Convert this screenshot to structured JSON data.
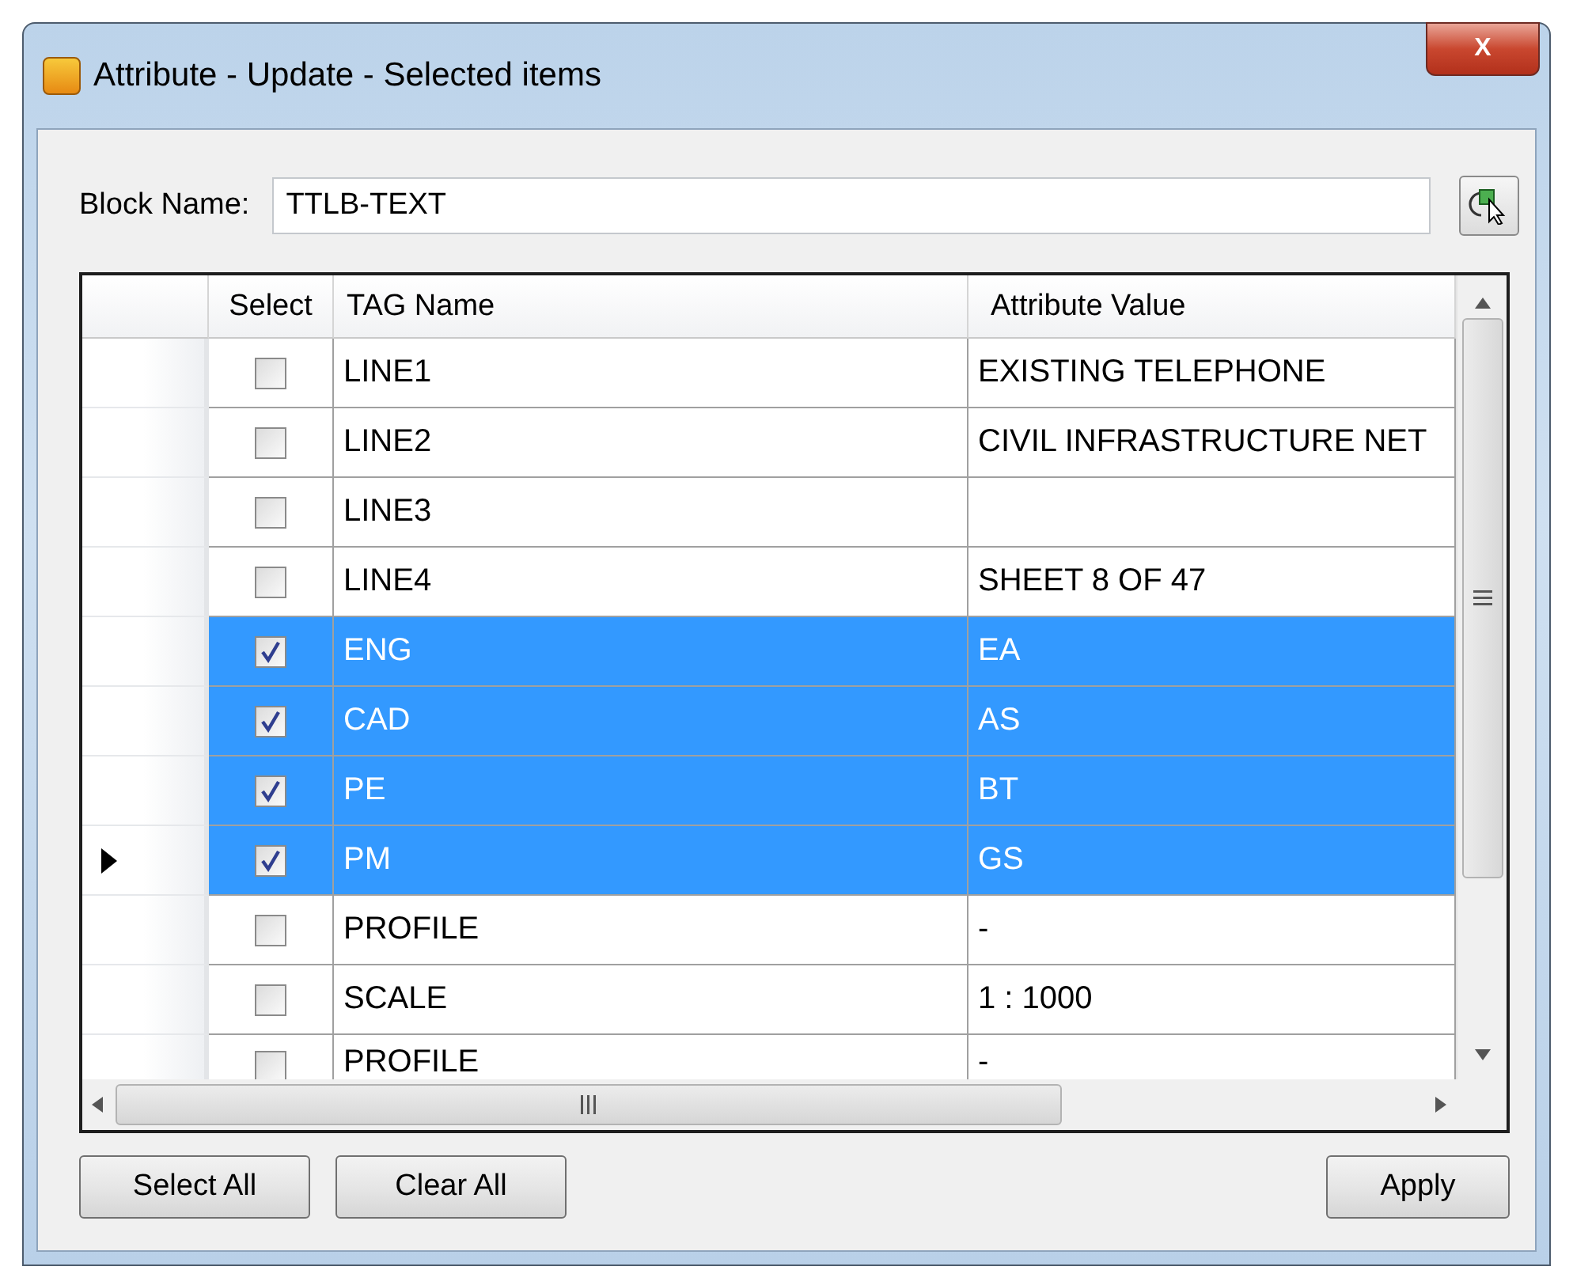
{
  "window": {
    "title": "Attribute - Update - Selected items",
    "close_label": "X"
  },
  "block_name": {
    "label": "Block Name:",
    "value": "TTLB-TEXT"
  },
  "table": {
    "columns": [
      "Select",
      "TAG Name",
      "Attribute Value"
    ],
    "rows": [
      {
        "tag": "LINE1",
        "value": "EXISTING TELEPHONE",
        "checked": false,
        "selected": false,
        "current": false
      },
      {
        "tag": "LINE2",
        "value": "CIVIL INFRASTRUCTURE NET",
        "checked": false,
        "selected": false,
        "current": false
      },
      {
        "tag": "LINE3",
        "checked": false,
        "selected": false,
        "current": false
      },
      {
        "tag": "LINE4",
        "value": "SHEET 8 OF 47",
        "checked": false,
        "selected": false,
        "current": false
      },
      {
        "tag": "ENG",
        "value": "EA",
        "checked": true,
        "selected": true,
        "current": false
      },
      {
        "tag": "CAD",
        "value": "AS",
        "checked": true,
        "selected": true,
        "current": false
      },
      {
        "tag": "PE",
        "value": "BT",
        "checked": true,
        "selected": true,
        "current": false
      },
      {
        "tag": "PM",
        "value": "GS",
        "checked": true,
        "selected": true,
        "current": true
      },
      {
        "tag": "PROFILE",
        "value": "-",
        "checked": false,
        "selected": false,
        "current": false
      },
      {
        "tag": "SCALE",
        "value": "1 : 1000",
        "checked": false,
        "selected": false,
        "current": false
      },
      {
        "tag": "PROFILE",
        "value": "-",
        "checked": false,
        "selected": false,
        "current": false
      }
    ]
  },
  "buttons": {
    "left": [
      "Select All",
      "Clear All"
    ],
    "right": [
      "Apply"
    ]
  }
}
